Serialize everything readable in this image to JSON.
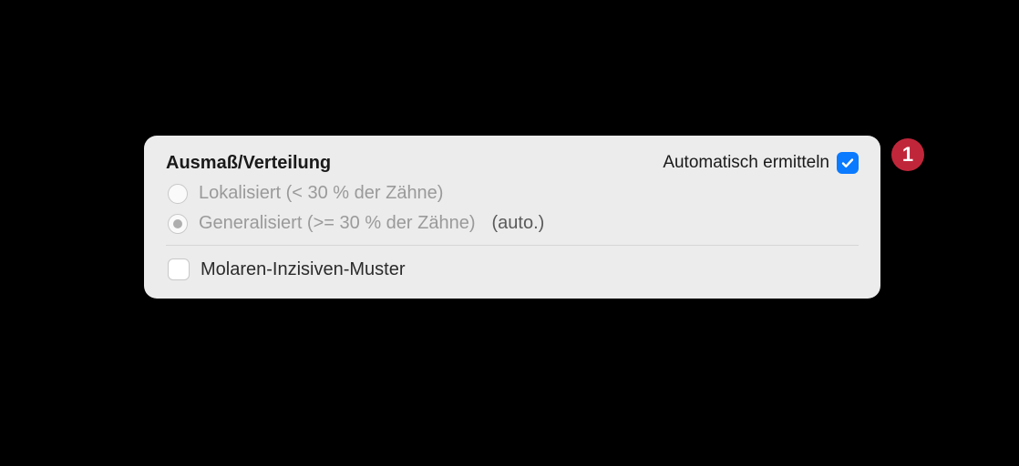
{
  "panel": {
    "title": "Ausmaß/Verteilung",
    "auto_detect_label": "Automatisch ermitteln",
    "auto_detect_checked": true,
    "options": [
      {
        "label": "Lokalisiert (< 30 % der Zähne)",
        "selected": false,
        "suffix": ""
      },
      {
        "label": "Generalisiert (>= 30 % der Zähne)",
        "selected": true,
        "suffix": "(auto.)"
      }
    ],
    "molar_incisor": {
      "label": "Molaren-Inzisiven-Muster",
      "checked": false
    }
  },
  "badge": {
    "number": "1",
    "color": "#c0263a"
  }
}
